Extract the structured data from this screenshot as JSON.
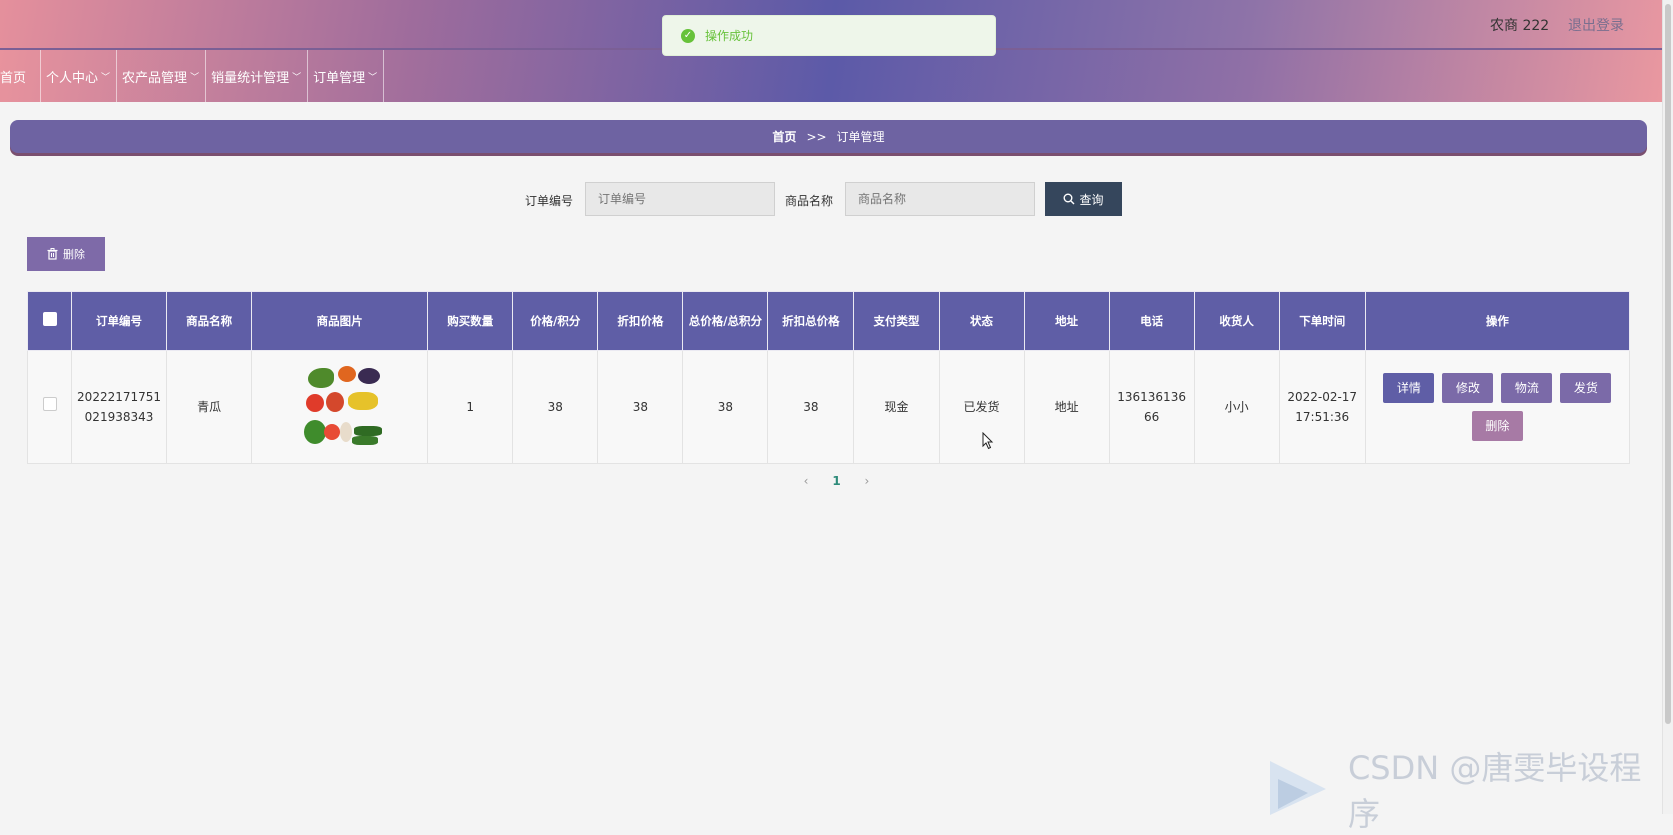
{
  "header": {
    "user": "农商 222",
    "logout": "退出登录"
  },
  "toast": {
    "message": "操作成功"
  },
  "nav": [
    {
      "label": "首页",
      "has_dropdown": false
    },
    {
      "label": "个人中心",
      "has_dropdown": true
    },
    {
      "label": "农产品管理",
      "has_dropdown": true
    },
    {
      "label": "销量统计管理",
      "has_dropdown": true
    },
    {
      "label": "订单管理",
      "has_dropdown": true
    }
  ],
  "breadcrumb": {
    "home": "首页",
    "separator": ">>",
    "current": "订单管理"
  },
  "search": {
    "order_no_label": "订单编号",
    "order_no_placeholder": "订单编号",
    "product_label": "商品名称",
    "product_placeholder": "商品名称",
    "query_label": "查询"
  },
  "toolbar": {
    "delete_label": "删除"
  },
  "table": {
    "columns": [
      "订单编号",
      "商品名称",
      "商品图片",
      "购买数量",
      "价格/积分",
      "折扣价格",
      "总价格/总积分",
      "折扣总价格",
      "支付类型",
      "状态",
      "地址",
      "电话",
      "收货人",
      "下单时间",
      "操作"
    ],
    "rows": [
      {
        "order_no": "20222171751021938343",
        "product": "青瓜",
        "quantity": "1",
        "price": "38",
        "discount_price": "38",
        "total_price": "38",
        "discount_total": "38",
        "pay_type": "现金",
        "status": "已发货",
        "address": "地址",
        "phone": "13613613666",
        "receiver": "小小",
        "order_time": "2022-02-17 17:51:36",
        "actions": [
          "详情",
          "修改",
          "物流",
          "发货",
          "删除"
        ]
      }
    ]
  },
  "pagination": {
    "prev": "‹",
    "current": "1",
    "next": "›"
  },
  "watermark": "CSDN @唐雯毕设程序"
}
